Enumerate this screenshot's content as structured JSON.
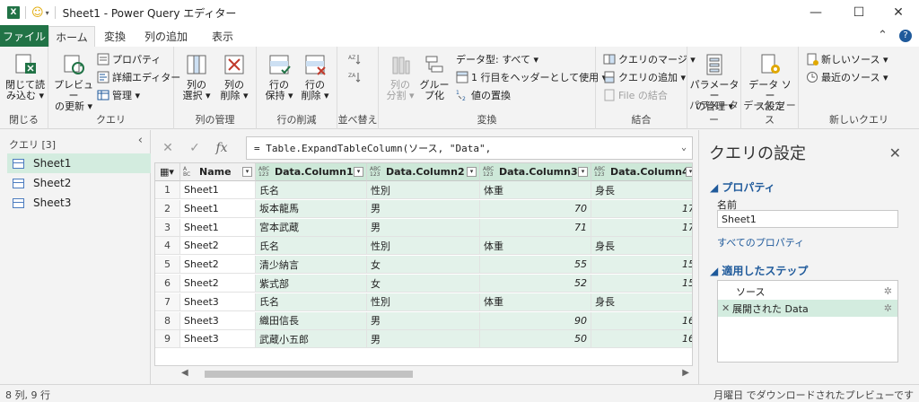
{
  "titlebar": {
    "app_icon": "X",
    "title": "Sheet1 - Power Query エディター",
    "minimize": "—",
    "maximize": "☐",
    "close": "✕"
  },
  "tabs": [
    {
      "label": "ファイル"
    },
    {
      "label": "ホーム"
    },
    {
      "label": "変換"
    },
    {
      "label": "列の追加"
    },
    {
      "label": "表示"
    }
  ],
  "ribbon": {
    "groups": {
      "close": "閉じる",
      "query": "クエリ",
      "manage_columns": "列の管理",
      "reduce_rows": "行の削減",
      "sort": "並べ替え",
      "transform": "変換",
      "combine": "結合",
      "parameters": "パラメーター",
      "data_sources": "データ ソース",
      "new_query": "新しいクエリ"
    },
    "close_load": [
      "閉じて読",
      "み込む ▾"
    ],
    "refresh_preview": [
      "プレビュー",
      "の更新 ▾"
    ],
    "properties": "プロパティ",
    "advanced_editor": "詳細エディター",
    "manage": "管理 ▾",
    "choose_columns": [
      "列の",
      "選択 ▾"
    ],
    "remove_columns": [
      "列の",
      "削除 ▾"
    ],
    "keep_rows": [
      "行の",
      "保持 ▾"
    ],
    "remove_rows": [
      "行の",
      "削除 ▾"
    ],
    "split_column": [
      "列の",
      "分割 ▾"
    ],
    "group_by": [
      "グルー",
      "プ化"
    ],
    "data_type": "データ型: すべて ▾",
    "first_row_header": "1 行目をヘッダーとして使用 ▾",
    "replace_values": "値の置換",
    "merge_queries": "クエリのマージ ▾",
    "append_queries": "クエリの追加 ▾",
    "combine_files": "File の結合",
    "manage_parameters": [
      "パラメーター",
      "の管理 ▾"
    ],
    "data_source_settings": [
      "データ ソー",
      "ス設定"
    ],
    "new_source": "新しいソース ▾",
    "recent_sources": "最近のソース ▾"
  },
  "query_pane": {
    "header": "クエリ [3]",
    "items": [
      {
        "label": "Sheet1"
      },
      {
        "label": "Sheet2"
      },
      {
        "label": "Sheet3"
      }
    ]
  },
  "formula_bar": {
    "cancel": "✕",
    "confirm": "✓",
    "fx": "fx",
    "formula": "= Table.ExpandTableColumn(ソース, \"Data\","
  },
  "grid": {
    "columns": [
      {
        "name": "Name",
        "type_top": "A",
        "type_bottom": "BC"
      },
      {
        "name": "Data.Column1",
        "type_top": "ABC",
        "type_bottom": "123"
      },
      {
        "name": "Data.Column2",
        "type_top": "ABC",
        "type_bottom": "123"
      },
      {
        "name": "Data.Column3",
        "type_top": "ABC",
        "type_bottom": "123"
      },
      {
        "name": "Data.Column4",
        "type_top": "ABC",
        "type_bottom": "123"
      }
    ],
    "rows": [
      [
        "1",
        "Sheet1",
        "氏名",
        "性別",
        "体重",
        "身長"
      ],
      [
        "2",
        "Sheet1",
        "坂本龍馬",
        "男",
        "70",
        "17"
      ],
      [
        "3",
        "Sheet1",
        "宮本武蔵",
        "男",
        "71",
        "17"
      ],
      [
        "4",
        "Sheet2",
        "氏名",
        "性別",
        "体重",
        "身長"
      ],
      [
        "5",
        "Sheet2",
        "清少納言",
        "女",
        "55",
        "15"
      ],
      [
        "6",
        "Sheet2",
        "紫式部",
        "女",
        "52",
        "15"
      ],
      [
        "7",
        "Sheet3",
        "氏名",
        "性別",
        "体重",
        "身長"
      ],
      [
        "8",
        "Sheet3",
        "織田信長",
        "男",
        "90",
        "16"
      ],
      [
        "9",
        "Sheet3",
        "武蔵小五郎",
        "男",
        "50",
        "16"
      ]
    ]
  },
  "settings": {
    "title": "クエリの設定",
    "close": "✕",
    "properties_header": "プロパティ",
    "name_label": "名前",
    "name_value": "Sheet1",
    "all_properties": "すべてのプロパティ",
    "steps_header": "適用したステップ",
    "steps": [
      {
        "label": "ソース",
        "prefix": ""
      },
      {
        "label": "展開された Data",
        "prefix": "✕"
      }
    ]
  },
  "status": {
    "left": "8 列, 9 行",
    "right": "月曜日 でダウンロードされたプレビューです"
  }
}
